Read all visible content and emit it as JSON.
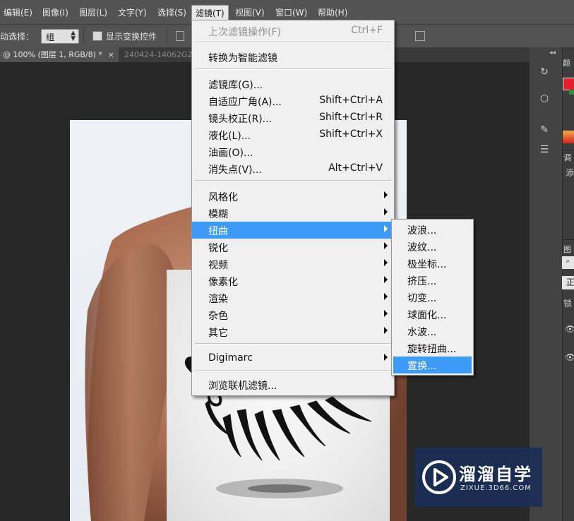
{
  "menubar": {
    "items": [
      "编辑(E)",
      "图像(I)",
      "图层(L)",
      "文字(Y)",
      "选择(S)",
      "滤镜(T)",
      "视图(V)",
      "窗口(W)",
      "帮助(H)"
    ]
  },
  "options": {
    "auto_select_label": "动选择：",
    "auto_select_value": "组",
    "show_transform_label": "显示变换控件"
  },
  "tabs": {
    "active": "@ 100% (图层 1, RGB/8) *",
    "active_close": "×",
    "second": "240424-14062G2"
  },
  "filter_menu": {
    "last_filter": {
      "label": "上次滤镜操作(F)",
      "shortcut": "Ctrl+F"
    },
    "smart": "转换为智能滤镜",
    "gallery": "滤镜库(G)...",
    "adaptive_wide": {
      "label": "自适应广角(A)...",
      "shortcut": "Shift+Ctrl+A"
    },
    "lens_correction": {
      "label": "镜头校正(R)...",
      "shortcut": "Shift+Ctrl+R"
    },
    "liquify": {
      "label": "液化(L)...",
      "shortcut": "Shift+Ctrl+X"
    },
    "oil_paint": "油画(O)...",
    "vanishing_point": {
      "label": "消失点(V)...",
      "shortcut": "Alt+Ctrl+V"
    },
    "stylize": "风格化",
    "blur": "模糊",
    "distort": "扭曲",
    "sharpen": "锐化",
    "video": "视频",
    "pixelate": "像素化",
    "render": "渲染",
    "noise": "杂色",
    "other": "其它",
    "digimarc": "Digimarc",
    "browse_online": "浏览联机滤镜..."
  },
  "distort_submenu": [
    "波浪...",
    "波纹...",
    "极坐标...",
    "挤压...",
    "切变...",
    "球面化...",
    "水波...",
    "旋转扭曲...",
    "置换..."
  ],
  "right_panel": {
    "color_tab": "颜",
    "adjust_tab": "调",
    "add_label": "添",
    "layers_tab": "图",
    "normal_label": "正",
    "lock_label": "锁"
  },
  "watermark": {
    "brand": "溜溜自学",
    "url": "ZIXUE.3D66.COM"
  },
  "colors": {
    "menu_highlight": "#3d9bf6",
    "foreground": "#e3202a",
    "watermark_bg": "#1c2f58"
  }
}
